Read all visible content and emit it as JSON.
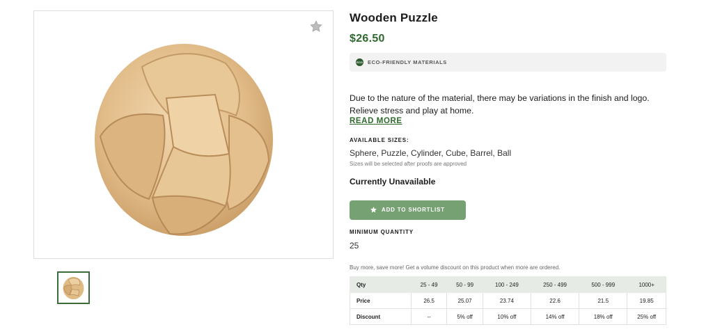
{
  "product": {
    "title": "Wooden Puzzle",
    "price": "$26.50",
    "image_alt": "wooden puzzle ball"
  },
  "badge": {
    "icon_text": "ECO",
    "label": "ECO-FRIENDLY MATERIALS"
  },
  "description": {
    "line1": "Due to the nature of the material, there may be variations in the finish and logo.",
    "line2": "Relieve stress and play at home.",
    "read_more": "READ MORE"
  },
  "sizes": {
    "heading": "AVAILABLE SIZES:",
    "values": "Sphere, Puzzle, Cylinder, Cube, Barrel, Ball",
    "note": "Sizes will be selected after proofs are approved"
  },
  "availability": "Currently Unavailable",
  "shortlist_button": "ADD TO SHORTLIST",
  "minimum_quantity": {
    "heading": "MINIMUM QUANTITY",
    "value": "25"
  },
  "volume": {
    "promo": "Buy more, save more! Get a volume discount on this product when more are ordered.",
    "rows": [
      {
        "label": "Qty",
        "cells": [
          "25 - 49",
          "50 - 99",
          "100 - 249",
          "250 - 499",
          "500 - 999",
          "1000+"
        ]
      },
      {
        "label": "Price",
        "cells": [
          "26.5",
          "25.07",
          "23.74",
          "22.6",
          "21.5",
          "19.85"
        ]
      },
      {
        "label": "Discount",
        "cells": [
          "--",
          "5% off",
          "10% off",
          "14% off",
          "18% off",
          "25% off"
        ]
      }
    ]
  },
  "colors": {
    "accent_green": "#2e6a2d",
    "button_green": "#76a173",
    "table_header_bg": "#e6ebe6"
  },
  "icons": [
    "star-favorite-icon",
    "eco-leaf-icon",
    "star-icon"
  ]
}
